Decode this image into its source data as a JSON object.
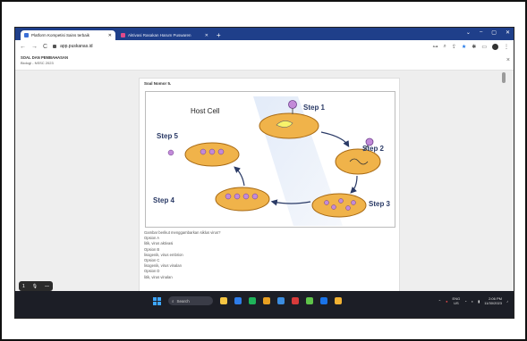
{
  "browser": {
    "tabs": [
      {
        "title": "Platform Kompetisi Sains terbaik",
        "active": true,
        "favicon_color": "#3b6fd6"
      },
      {
        "title": "Aktivasi Rasakan Harum Puswaren",
        "active": false,
        "favicon_color": "#e04a8a"
      }
    ],
    "new_tab_label": "+",
    "window_controls": [
      "⌄",
      "–",
      "▢",
      "✕"
    ],
    "url": "app.puskanas.id",
    "nav": {
      "back": "←",
      "forward": "→",
      "reload": "C"
    }
  },
  "page_header": {
    "title": "SOAL DAN PEMBAHASAN",
    "subtitle": "Biologi - NSSC 2023",
    "close": "×"
  },
  "question": {
    "title": "Soal Nomor 5.",
    "diagram": {
      "host_cell_label": "Host Cell",
      "steps": [
        "Step 1",
        "Step 2",
        "Step 3",
        "Step 4",
        "Step 5"
      ]
    },
    "prompt": "Gambar berikut menggambarkan siklus virus?",
    "options": [
      {
        "label": "Opsion A",
        "text": "litik, virus aktivasi"
      },
      {
        "label": "Opsion B",
        "text": "lisogenik, virus embrion"
      },
      {
        "label": "Opsion C",
        "text": "lisogenik, virus vinalan"
      },
      {
        "label": "Opsion D",
        "text": "litik, virus vinalan"
      }
    ]
  },
  "pdf_controls": {
    "page": "1",
    "mic": "🎙",
    "minus": "—"
  },
  "taskbar": {
    "search_placeholder": "Search",
    "apps": [
      "#f5c542",
      "#2e7de9",
      "#1fb35a",
      "#e8a022",
      "#3c8de0",
      "#d83a3a",
      "#5fc44a",
      "#1a73e8",
      "#f2b233"
    ],
    "language_top": "ENG",
    "language_bottom": "US",
    "time": "2:06 PM",
    "date": "11/30/2023"
  }
}
